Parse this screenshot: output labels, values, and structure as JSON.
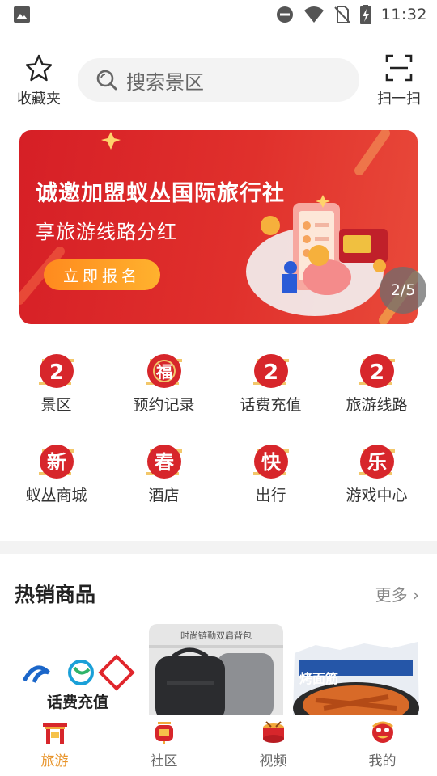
{
  "status_bar": {
    "time": "11:32"
  },
  "header": {
    "favorites_label": "收藏夹",
    "search_placeholder": "搜索景区",
    "scan_label": "扫一扫"
  },
  "banner": {
    "title": "诚邀加盟蚁丛国际旅行社",
    "subtitle": "享旅游线路分红",
    "button_label": "立即报名",
    "indicator": "2/5"
  },
  "grid": {
    "items": [
      {
        "label": "景区",
        "glyph": "2"
      },
      {
        "label": "预约记录",
        "glyph": "福"
      },
      {
        "label": "话费充值",
        "glyph": "2"
      },
      {
        "label": "旅游线路",
        "glyph": "2"
      },
      {
        "label": "蚁丛商城",
        "glyph": "新"
      },
      {
        "label": "酒店",
        "glyph": "春"
      },
      {
        "label": "出行",
        "glyph": "快"
      },
      {
        "label": "游戏中心",
        "glyph": "乐"
      }
    ]
  },
  "hot_products": {
    "title": "热销商品",
    "more_label": "更多",
    "items": [
      {
        "caption": "话费充值"
      },
      {
        "caption": "时尚链勤双肩背包"
      },
      {
        "caption": "烤面筋"
      }
    ]
  },
  "bottom_nav": {
    "items": [
      {
        "label": "旅游",
        "active": true
      },
      {
        "label": "社区",
        "active": false
      },
      {
        "label": "视频",
        "active": false
      },
      {
        "label": "我的",
        "active": false
      }
    ]
  },
  "colors": {
    "accent": "#e8942a",
    "banner_red": "#d61f26",
    "badge_red": "#d7262b",
    "badge_gold": "#f2c76a"
  }
}
